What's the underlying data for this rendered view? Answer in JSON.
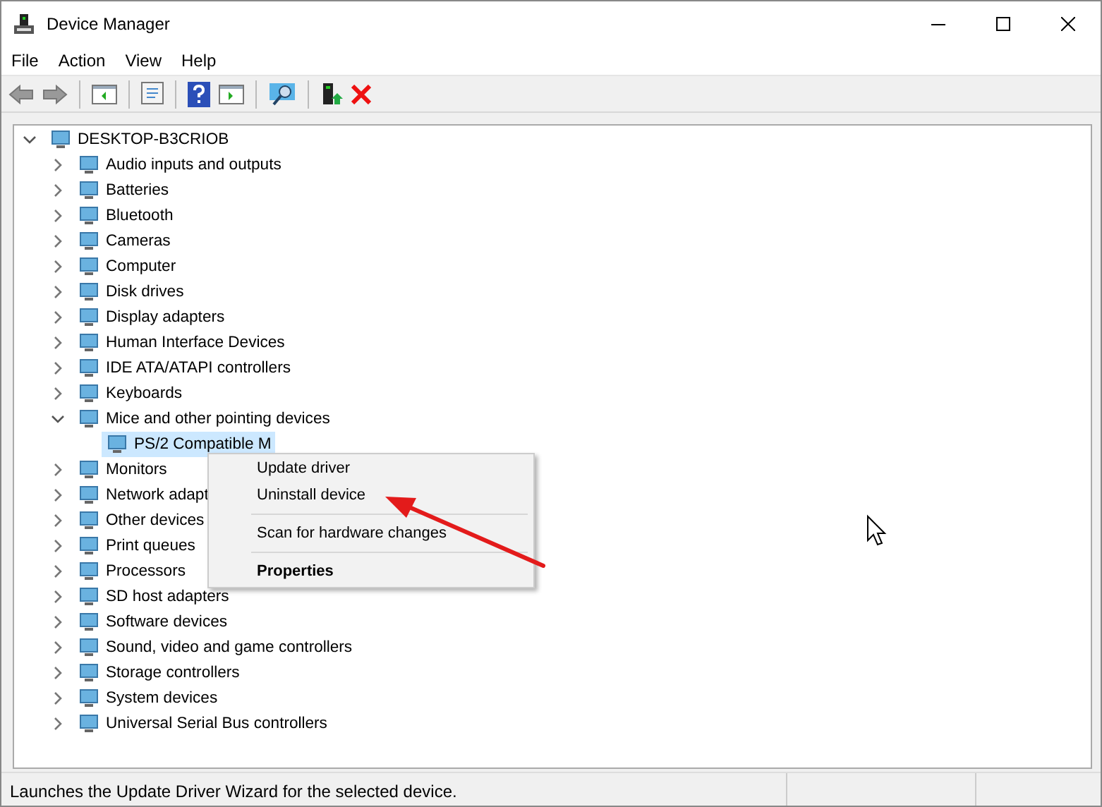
{
  "window": {
    "title": "Device Manager"
  },
  "menu_bar": [
    "File",
    "Action",
    "View",
    "Help"
  ],
  "tree": [
    {
      "label": "DESKTOP-B3CRIOB",
      "expanded": true,
      "selected": false,
      "children": [
        {
          "label": "Audio inputs and outputs",
          "expanded": false,
          "selected": false
        },
        {
          "label": "Batteries",
          "expanded": false,
          "selected": false
        },
        {
          "label": "Bluetooth",
          "expanded": false,
          "selected": false
        },
        {
          "label": "Cameras",
          "expanded": false,
          "selected": false
        },
        {
          "label": "Computer",
          "expanded": false,
          "selected": false
        },
        {
          "label": "Disk drives",
          "expanded": false,
          "selected": false
        },
        {
          "label": "Display adapters",
          "expanded": false,
          "selected": false
        },
        {
          "label": "Human Interface Devices",
          "expanded": false,
          "selected": false
        },
        {
          "label": "IDE ATA/ATAPI controllers",
          "expanded": false,
          "selected": false
        },
        {
          "label": "Keyboards",
          "expanded": false,
          "selected": false
        },
        {
          "label": "Mice and other pointing devices",
          "expanded": true,
          "selected": false,
          "children": [
            {
              "label": "PS/2 Compatible M",
              "selected": true
            }
          ]
        },
        {
          "label": "Monitors",
          "expanded": false,
          "selected": false
        },
        {
          "label": "Network adapt",
          "expanded": false,
          "selected": false
        },
        {
          "label": "Other devices",
          "expanded": false,
          "selected": false
        },
        {
          "label": "Print queues",
          "expanded": false,
          "selected": false
        },
        {
          "label": "Processors",
          "expanded": false,
          "selected": false
        },
        {
          "label": "SD host adapters",
          "expanded": false,
          "selected": false
        },
        {
          "label": "Software devices",
          "expanded": false,
          "selected": false
        },
        {
          "label": "Sound, video and game controllers",
          "expanded": false,
          "selected": false
        },
        {
          "label": "Storage controllers",
          "expanded": false,
          "selected": false
        },
        {
          "label": "System devices",
          "expanded": false,
          "selected": false
        },
        {
          "label": "Universal Serial Bus controllers",
          "expanded": false,
          "selected": false
        }
      ]
    }
  ],
  "context_menu": [
    {
      "kind": "item",
      "label": "Update driver"
    },
    {
      "kind": "item",
      "label": "Uninstall device"
    },
    {
      "kind": "separator"
    },
    {
      "kind": "item",
      "label": "Scan for hardware changes"
    },
    {
      "kind": "separator"
    },
    {
      "kind": "default",
      "label": "Properties"
    }
  ],
  "status_bar": {
    "text": "Launches the Update Driver Wizard for the selected device."
  }
}
